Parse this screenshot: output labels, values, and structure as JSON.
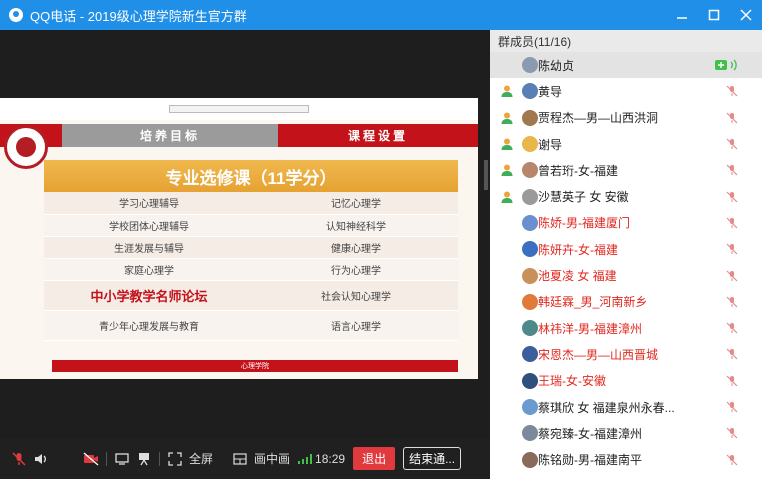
{
  "window": {
    "title": "QQ电话 - 2019级心理学院新生官方群",
    "controls": [
      "minimize",
      "maximize",
      "close"
    ]
  },
  "slide": {
    "tab_left": "培养目标",
    "tab_right": "课程设置",
    "header": "专业选修课（11学分）",
    "rows": [
      [
        "学习心理辅导",
        "记忆心理学"
      ],
      [
        "学校团体心理辅导",
        "认知神经科学"
      ],
      [
        "生涯发展与辅导",
        "健康心理学"
      ],
      [
        "家庭心理学",
        "行为心理学"
      ],
      [
        "中小学教学名师论坛",
        "社会认知心理学"
      ],
      [
        "青少年心理发展与教育",
        "语言心理学"
      ]
    ],
    "footer": "心理学院"
  },
  "toolbar": {
    "fullscreen": "全屏",
    "pip": "画中画",
    "time": "18:29",
    "exit": "退出",
    "end": "结束通..."
  },
  "panel": {
    "header": "群成员(11/16)",
    "members": [
      {
        "name": "陈幼贞",
        "red": false,
        "role": false,
        "speaking": true
      },
      {
        "name": "黄导",
        "red": false,
        "role": true,
        "speaking": false
      },
      {
        "name": "贾程杰—男—山西洪洞",
        "red": false,
        "role": true,
        "speaking": false
      },
      {
        "name": "谢导",
        "red": false,
        "role": true,
        "speaking": false
      },
      {
        "name": "曾若珩-女-福建",
        "red": false,
        "role": true,
        "speaking": false
      },
      {
        "name": "沙慧英子 女 安徽",
        "red": false,
        "role": true,
        "speaking": false
      },
      {
        "name": "陈娇-男-福建厦门",
        "red": true,
        "role": false,
        "speaking": false
      },
      {
        "name": "陈妍卉-女-福建",
        "red": true,
        "role": false,
        "speaking": false
      },
      {
        "name": "池夏凌 女 福建",
        "red": true,
        "role": false,
        "speaking": false
      },
      {
        "name": "韩廷霖_男_河南新乡",
        "red": true,
        "role": false,
        "speaking": false
      },
      {
        "name": "林祎洋-男-福建漳州",
        "red": true,
        "role": false,
        "speaking": false
      },
      {
        "name": "宋恩杰—男—山西晋城",
        "red": true,
        "role": false,
        "speaking": false
      },
      {
        "name": "王瑞-女-安徽",
        "red": true,
        "role": false,
        "speaking": false
      },
      {
        "name": "蔡琪欣 女 福建泉州永春...",
        "red": false,
        "role": false,
        "speaking": false
      },
      {
        "name": "蔡宛臻-女-福建漳州",
        "red": false,
        "role": false,
        "speaking": false
      },
      {
        "name": "陈铭勋-男-福建南平",
        "red": false,
        "role": false,
        "speaking": false
      }
    ]
  },
  "colors": {
    "titlebar": "#1f8fe8",
    "accent_red": "#c3121a",
    "header_gold": "#e6a233",
    "exit_button": "#e0393e"
  }
}
